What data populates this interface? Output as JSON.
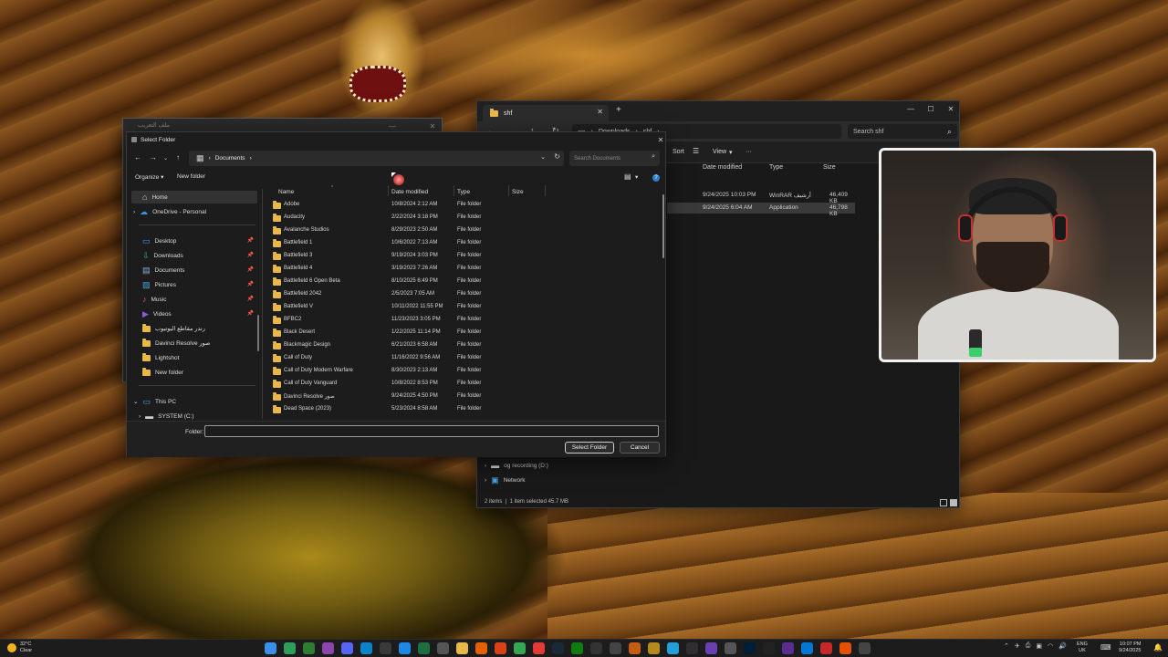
{
  "ghost_window": {
    "title": "ملف التعريب"
  },
  "explorer": {
    "tab_title": "shf",
    "breadcrumb": [
      "Downloads",
      "shf"
    ],
    "search_placeholder": "Search shf",
    "toolbar": {
      "sort": "Sort",
      "view": "View",
      "more": "···"
    },
    "columns": {
      "date": "Date modified",
      "type": "Type",
      "size": "Size"
    },
    "files": [
      {
        "date": "9/24/2025 10:03 PM",
        "type": "WinRAR أرشيف",
        "size": "46,409 KB",
        "selected": false
      },
      {
        "date": "9/24/2025 6:04 AM",
        "type": "Application",
        "size": "46,798 KB",
        "selected": true
      }
    ],
    "nav": [
      {
        "label": "og recording (D:)",
        "icon": "drive-icon"
      },
      {
        "label": "Network",
        "icon": "network-icon"
      }
    ],
    "status": {
      "count": "2 items",
      "selection": "1 item selected  45.7 MB"
    }
  },
  "dialog": {
    "title": "Select Folder",
    "address": "Documents",
    "search_placeholder": "Search Documents",
    "toolbar": {
      "organize": "Organize ▾",
      "new_folder": "New folder"
    },
    "columns": {
      "name": "Name",
      "date": "Date modified",
      "type": "Type",
      "size": "Size"
    },
    "sidebar": [
      {
        "label": "Home",
        "icon": "home-icon",
        "selected": true,
        "pinned": false,
        "expand": false
      },
      {
        "label": "OneDrive - Personal",
        "icon": "cloud-icon",
        "selected": false,
        "pinned": false,
        "expand": true
      },
      {
        "label": "Desktop",
        "icon": "desktop-icon",
        "selected": false,
        "pinned": true,
        "expand": false
      },
      {
        "label": "Downloads",
        "icon": "download-icon",
        "selected": false,
        "pinned": true,
        "expand": false
      },
      {
        "label": "Documents",
        "icon": "documents-icon",
        "selected": false,
        "pinned": true,
        "expand": false
      },
      {
        "label": "Pictures",
        "icon": "pictures-icon",
        "selected": false,
        "pinned": true,
        "expand": false
      },
      {
        "label": "Music",
        "icon": "music-icon",
        "selected": false,
        "pinned": true,
        "expand": false
      },
      {
        "label": "Videos",
        "icon": "videos-icon",
        "selected": false,
        "pinned": true,
        "expand": false
      },
      {
        "label": "رندر مقاطع اليوتيوب",
        "icon": "folder-icon",
        "selected": false,
        "pinned": false,
        "expand": false
      },
      {
        "label": "Davinci Resolve صور",
        "icon": "folder-icon",
        "selected": false,
        "pinned": false,
        "expand": false
      },
      {
        "label": "Lightshot",
        "icon": "folder-icon",
        "selected": false,
        "pinned": false,
        "expand": false
      },
      {
        "label": "New folder",
        "icon": "folder-icon",
        "selected": false,
        "pinned": false,
        "expand": false
      },
      {
        "label": "This PC",
        "icon": "pc-icon",
        "selected": false,
        "pinned": false,
        "expand": true
      },
      {
        "label": "SYSTEM (C:)",
        "icon": "drive-icon",
        "selected": false,
        "pinned": false,
        "expand": true
      }
    ],
    "files": [
      {
        "name": "Adobe",
        "date": "10/8/2024 2:12 AM",
        "type": "File folder"
      },
      {
        "name": "Audacity",
        "date": "2/22/2024 3:18 PM",
        "type": "File folder"
      },
      {
        "name": "Avalanche Studios",
        "date": "8/29/2023 2:50 AM",
        "type": "File folder"
      },
      {
        "name": "Battlefield 1",
        "date": "10/6/2022 7:13 AM",
        "type": "File folder"
      },
      {
        "name": "Battlefield 3",
        "date": "9/19/2024 3:03 PM",
        "type": "File folder"
      },
      {
        "name": "Battlefield 4",
        "date": "3/19/2023 7:26 AM",
        "type": "File folder"
      },
      {
        "name": "Battlefield 6 Open Beta",
        "date": "8/10/2025 6:49 PM",
        "type": "File folder"
      },
      {
        "name": "Battlefield 2042",
        "date": "2/5/2023 7:05 AM",
        "type": "File folder"
      },
      {
        "name": "Battlefield V",
        "date": "10/11/2022 11:55 PM",
        "type": "File folder"
      },
      {
        "name": "BFBC2",
        "date": "11/23/2023 3:05 PM",
        "type": "File folder"
      },
      {
        "name": "Black Desert",
        "date": "1/22/2025 11:14 PM",
        "type": "File folder"
      },
      {
        "name": "Blackmagic Design",
        "date": "6/21/2023 6:58 AM",
        "type": "File folder"
      },
      {
        "name": "Call of Duty",
        "date": "11/16/2022 9:56 AM",
        "type": "File folder"
      },
      {
        "name": "Call of Duty Modern Warfare",
        "date": "8/30/2023 2:13 AM",
        "type": "File folder"
      },
      {
        "name": "Call of Duty Vanguard",
        "date": "10/8/2022 8:53 PM",
        "type": "File folder"
      },
      {
        "name": "Davinci Resolve صور",
        "date": "9/24/2025 4:50 PM",
        "type": "File folder"
      },
      {
        "name": "Dead Space (2023)",
        "date": "5/23/2024 8:58 AM",
        "type": "File folder"
      }
    ],
    "folder_label": "Folder:",
    "folder_value": "",
    "select_button": "Select Folder",
    "cancel_button": "Cancel"
  },
  "taskbar": {
    "weather": {
      "temp": "32°C",
      "condition": "Clear"
    },
    "language": {
      "code": "ENG",
      "region": "UK"
    },
    "clock": {
      "time": "10:07 PM",
      "date": "9/24/2025"
    },
    "apps": [
      {
        "icon": "start-icon",
        "color": "#3a8fe8"
      },
      {
        "icon": "search-icon",
        "color": "#2f9e5a"
      },
      {
        "icon": "xbox-icon",
        "color": "#2e7d32"
      },
      {
        "icon": "pen-icon",
        "color": "#8e44ad"
      },
      {
        "icon": "discord-icon",
        "color": "#5865f2"
      },
      {
        "icon": "edge-icon",
        "color": "#0a84c6"
      },
      {
        "icon": "chatgpt-icon",
        "color": "#3a3a3a"
      },
      {
        "icon": "onedrive-icon",
        "color": "#1e88e5"
      },
      {
        "icon": "excel-icon",
        "color": "#1d6f42"
      },
      {
        "icon": "shield-icon",
        "color": "#555555"
      },
      {
        "icon": "explorer-icon",
        "color": "#e8b94a"
      },
      {
        "icon": "firefox-icon",
        "color": "#e66000"
      },
      {
        "icon": "brave-icon",
        "color": "#d84315"
      },
      {
        "icon": "chrome-icon",
        "color": "#34a853"
      },
      {
        "icon": "youtube-icon",
        "color": "#e53935"
      },
      {
        "icon": "steam-icon",
        "color": "#1b2838"
      },
      {
        "icon": "xbox-app-icon",
        "color": "#107c10"
      },
      {
        "icon": "epic-icon",
        "color": "#333333"
      },
      {
        "icon": "ea-icon",
        "color": "#444444"
      },
      {
        "icon": "resolve-icon",
        "color": "#c75b12"
      },
      {
        "icon": "r-icon",
        "color": "#b58a1c"
      },
      {
        "icon": "telegram-icon",
        "color": "#229ed9"
      },
      {
        "icon": "obs-icon",
        "color": "#302e31"
      },
      {
        "icon": "circle-app-icon",
        "color": "#6a3fb0"
      },
      {
        "icon": "disc-icon",
        "color": "#555555"
      },
      {
        "icon": "photoshop-icon",
        "color": "#001e36"
      },
      {
        "icon": "capcut-icon",
        "color": "#222222"
      },
      {
        "icon": "vs-icon",
        "color": "#5c2d91"
      },
      {
        "icon": "desktop-app-icon",
        "color": "#0078d4"
      },
      {
        "icon": "record-icon",
        "color": "#c62828"
      },
      {
        "icon": "tools-icon",
        "color": "#e65100"
      },
      {
        "icon": "game-icon",
        "color": "#444444"
      }
    ]
  }
}
